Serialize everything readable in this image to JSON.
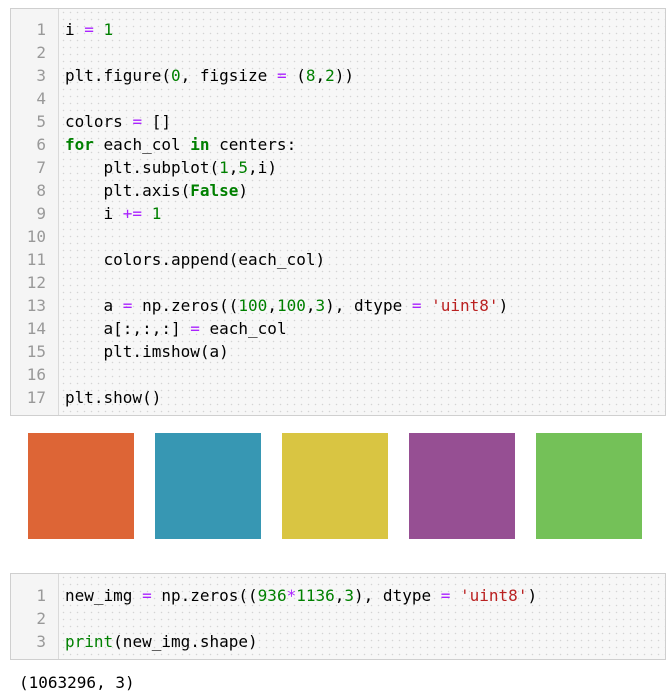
{
  "cell1": {
    "lines": [
      {
        "n": "1",
        "parts": [
          [
            "i "
          ],
          [
            "=",
            "op"
          ],
          [
            " "
          ],
          [
            "1",
            "num"
          ]
        ]
      },
      {
        "n": "2",
        "parts": []
      },
      {
        "n": "3",
        "parts": [
          [
            "plt.figure("
          ],
          [
            "0",
            "num"
          ],
          [
            ", figsize "
          ],
          [
            "=",
            "op"
          ],
          [
            " ("
          ],
          [
            "8",
            "num"
          ],
          [
            ","
          ],
          [
            "2",
            "num"
          ],
          [
            "))"
          ]
        ]
      },
      {
        "n": "4",
        "parts": []
      },
      {
        "n": "5",
        "parts": [
          [
            "colors "
          ],
          [
            "=",
            "op"
          ],
          [
            " []"
          ]
        ]
      },
      {
        "n": "6",
        "parts": [
          [
            "for",
            "kw"
          ],
          [
            " each_col "
          ],
          [
            "in",
            "kw"
          ],
          [
            " centers:"
          ]
        ]
      },
      {
        "n": "7",
        "parts": [
          [
            "    plt.subplot("
          ],
          [
            "1",
            "num"
          ],
          [
            ","
          ],
          [
            "5",
            "num"
          ],
          [
            ",i)"
          ]
        ]
      },
      {
        "n": "8",
        "parts": [
          [
            "    plt.axis("
          ],
          [
            "False",
            "kw"
          ],
          [
            ")"
          ]
        ]
      },
      {
        "n": "9",
        "parts": [
          [
            "    i "
          ],
          [
            "+=",
            "op"
          ],
          [
            " "
          ],
          [
            "1",
            "num"
          ]
        ]
      },
      {
        "n": "10",
        "parts": []
      },
      {
        "n": "11",
        "parts": [
          [
            "    colors.append(each_col)"
          ]
        ]
      },
      {
        "n": "12",
        "parts": []
      },
      {
        "n": "13",
        "parts": [
          [
            "    a "
          ],
          [
            "=",
            "op"
          ],
          [
            " np.zeros(("
          ],
          [
            "100",
            "num"
          ],
          [
            ","
          ],
          [
            "100",
            "num"
          ],
          [
            ","
          ],
          [
            "3",
            "num"
          ],
          [
            "), dtype "
          ],
          [
            "=",
            "op"
          ],
          [
            " "
          ],
          [
            "'uint8'",
            "str"
          ],
          [
            ")"
          ]
        ]
      },
      {
        "n": "14",
        "parts": [
          [
            "    a[:,:,:] "
          ],
          [
            "=",
            "op"
          ],
          [
            " each_col"
          ]
        ]
      },
      {
        "n": "15",
        "parts": [
          [
            "    plt.imshow(a)"
          ]
        ]
      },
      {
        "n": "16",
        "parts": []
      },
      {
        "n": "17",
        "parts": [
          [
            "plt.show()"
          ]
        ]
      }
    ]
  },
  "swatches": [
    {
      "color": "#dd6536"
    },
    {
      "color": "#3797b3"
    },
    {
      "color": "#d9c542"
    },
    {
      "color": "#964f93"
    },
    {
      "color": "#74c158"
    }
  ],
  "cell2": {
    "lines": [
      {
        "n": "1",
        "parts": [
          [
            "new_img "
          ],
          [
            "=",
            "op"
          ],
          [
            " np.zeros(("
          ],
          [
            "936",
            "num"
          ],
          [
            "*",
            "op"
          ],
          [
            "1136",
            "num"
          ],
          [
            ","
          ],
          [
            "3",
            "num"
          ],
          [
            "), dtype "
          ],
          [
            "=",
            "op"
          ],
          [
            " "
          ],
          [
            "'uint8'",
            "str"
          ],
          [
            ")"
          ]
        ]
      },
      {
        "n": "2",
        "parts": []
      },
      {
        "n": "3",
        "parts": [
          [
            "print",
            "num"
          ],
          [
            "(new_img.shape)"
          ]
        ]
      }
    ]
  },
  "output": {
    "text": "(1063296, 3)"
  }
}
